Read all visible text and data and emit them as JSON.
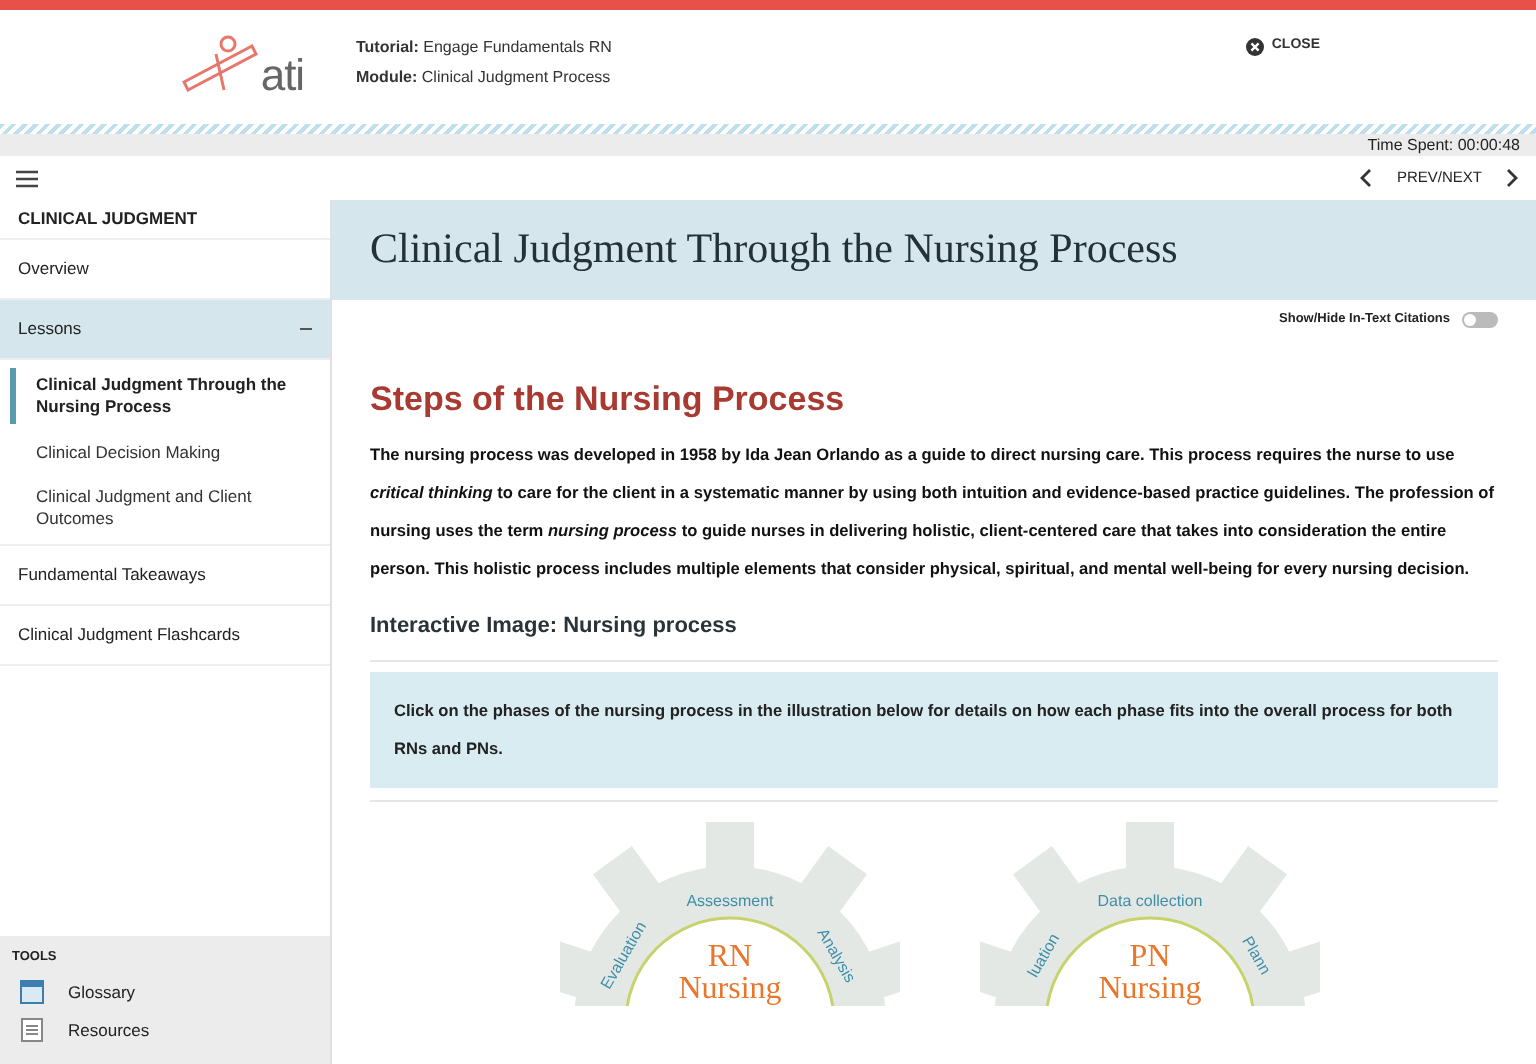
{
  "header": {
    "logo_text": "ati",
    "tutorial_label": "Tutorial:",
    "tutorial": "Engage Fundamentals RN",
    "module_label": "Module:",
    "module": "Clinical Judgment Process",
    "close": "CLOSE"
  },
  "time_spent": "Time Spent: 00:00:48",
  "nav": {
    "prev_next": "PREV/NEXT"
  },
  "sidebar": {
    "title": "CLINICAL JUDGMENT",
    "items": [
      {
        "label": "Overview",
        "selected": false
      },
      {
        "label": "Lessons",
        "selected": true,
        "expanded": true,
        "children": [
          {
            "label": "Clinical Judgment Through the Nursing Process",
            "selected": true
          },
          {
            "label": "Clinical Decision Making",
            "selected": false
          },
          {
            "label": "Clinical Judgment and Client Outcomes",
            "selected": false
          }
        ]
      },
      {
        "label": "Fundamental Takeaways",
        "selected": false
      },
      {
        "label": "Clinical Judgment Flashcards",
        "selected": false
      }
    ],
    "tools_title": "TOOLS",
    "tools": [
      {
        "label": "Glossary",
        "kind": "glossary"
      },
      {
        "label": "Resources",
        "kind": "resources"
      }
    ]
  },
  "content": {
    "title": "Clinical Judgment Through the Nursing Process",
    "citations_toggle": {
      "label": "Show/Hide In-Text Citations",
      "on": false
    },
    "heading": "Steps of the Nursing Process",
    "paragraph": "The nursing process was developed in 1958 by Ida Jean Orlando as a guide to direct nursing care. This process requires the nurse to use *critical thinking* to care for the client in a systematic manner by using both intuition and evidence-based practice guidelines. The profession of nursing uses the term *nursing process* to guide nurses in delivering holistic, client-centered care that takes into consideration the entire person. This holistic process includes multiple elements that consider physical, spiritual, and mental well-being for every nursing decision.",
    "subheading": "Interactive Image: Nursing process",
    "instruction": "Click on the phases of the nursing process in the illustration below for details on how each phase fits into the overall process for both RNs and PNs.",
    "gears": [
      {
        "top": "Assessment",
        "left": "Evaluation",
        "right": "Analysis",
        "center": [
          "RN",
          "Nursing"
        ]
      },
      {
        "top": "Data collection",
        "left": "luation",
        "right": "Plann",
        "center": [
          "PN",
          "Nursing"
        ]
      }
    ]
  }
}
